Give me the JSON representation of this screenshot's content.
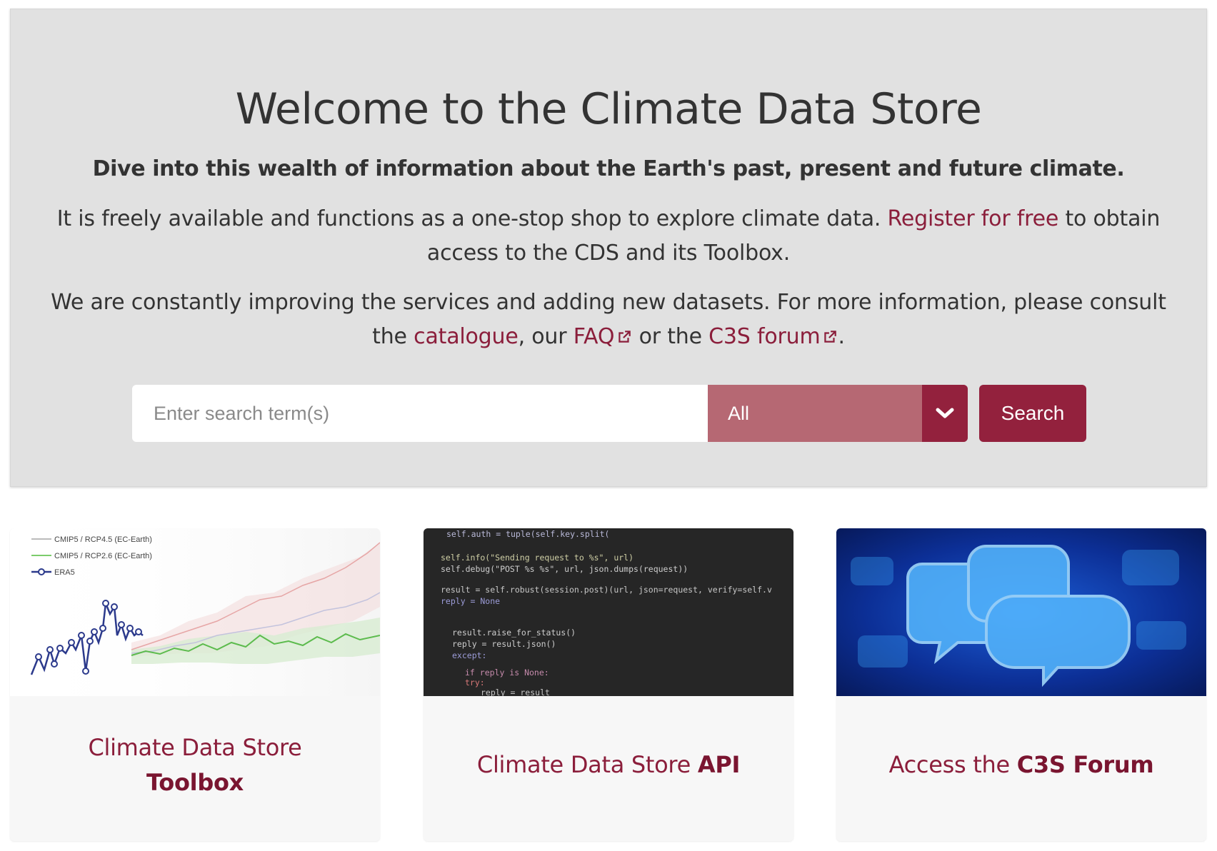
{
  "hero": {
    "title": "Welcome to the Climate Data Store",
    "lead": "Dive into this wealth of information about the Earth's past, present and future climate.",
    "p1_before": "It is freely available and functions as a one-stop shop to explore climate data. ",
    "p1_link": "Register for free",
    "p1_after": " to obtain access to the CDS and its Toolbox.",
    "p2_before": "We are constantly improving the services and adding new datasets. For more information, please consult the ",
    "p2_link_catalogue": "catalogue",
    "p2_mid1": ", our ",
    "p2_link_faq": "FAQ",
    "p2_mid2": " or the ",
    "p2_link_forum": "C3S forum",
    "p2_end": "."
  },
  "search": {
    "placeholder": "Enter search term(s)",
    "selected_option": "All",
    "button_label": "Search"
  },
  "cards": {
    "toolbox": {
      "caption_line1": "Climate Data Store",
      "caption_bold": "Toolbox",
      "legend": [
        "CMIP5 / RCP4.5 (EC-Earth)",
        "CMIP5 / RCP2.6 (EC-Earth)",
        "ERA5"
      ]
    },
    "api": {
      "caption_line1": "Climate Data Store ",
      "caption_bold": "API",
      "code_lines": [
        "self.auth = tuple(self.key.split(",
        "self.info(\"Sending request to %s\", url)",
        "self.debug(\"POST %s %s\", url, json.dumps(request))",
        "result = self.robust(session.post)(url, json=request, verify=self.v",
        "reply = None",
        "result.raise_for_status()",
        "reply = result.json()",
        "except:",
        "if reply is None:",
        "try:",
        "reply = result"
      ]
    },
    "forum": {
      "caption_line1": "Access the ",
      "caption_bold": "C3S Forum"
    }
  },
  "colors": {
    "brand": "#93213d",
    "link": "#8b1e3b",
    "select_bg": "#b66873",
    "hero_bg": "#e1e1e1"
  }
}
